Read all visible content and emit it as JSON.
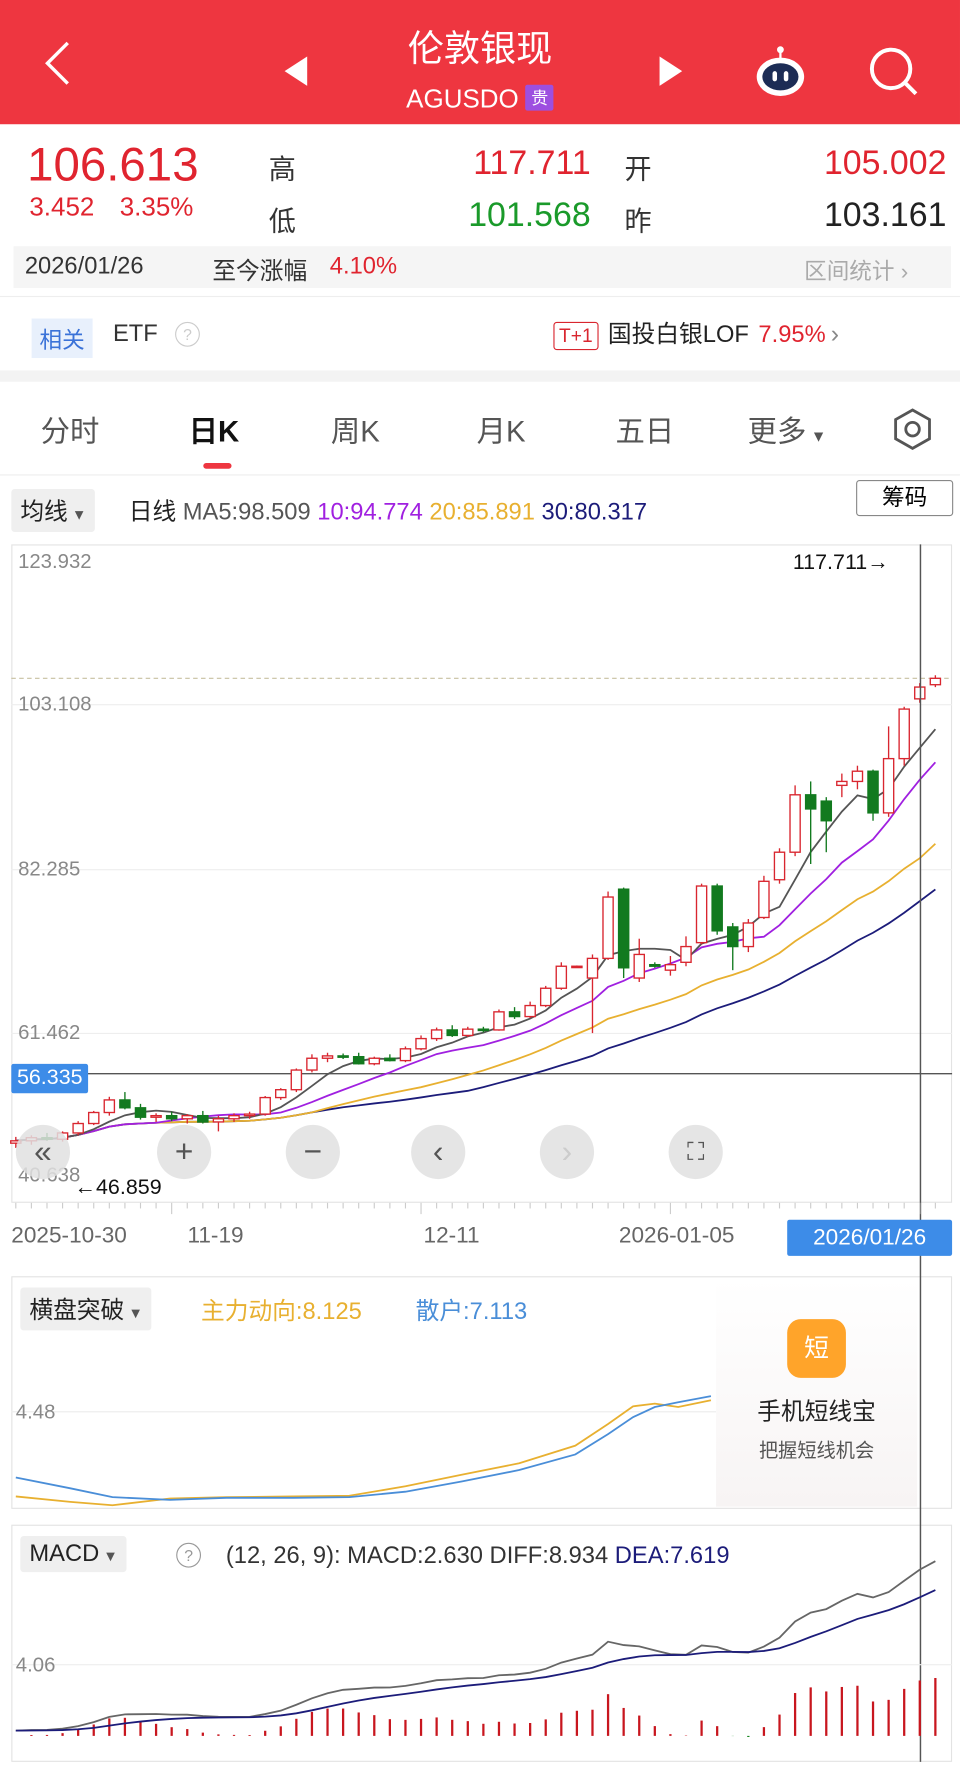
{
  "header": {
    "title": "伦敦银现",
    "code": "AGUSDO",
    "badge": "贵"
  },
  "quote": {
    "price": "106.613",
    "change": "3.452",
    "change_pct": "3.35%",
    "high_label": "高",
    "high": "117.711",
    "low_label": "低",
    "low": "101.568",
    "open_label": "开",
    "open": "105.002",
    "prev_label": "昨",
    "prev": "103.161"
  },
  "range": {
    "date": "2026/01/26",
    "label": "至今涨幅",
    "value": "4.10%",
    "stats": "区间统计"
  },
  "related": {
    "tag": "相关",
    "etf": "ETF",
    "t1": "T+1",
    "fund": "国投白银LOF",
    "pct": "7.95%"
  },
  "tabs": [
    "分时",
    "日K",
    "周K",
    "月K",
    "五日",
    "更多"
  ],
  "ma": {
    "selector": "均线",
    "period": "日线",
    "ma5": "MA5:98.509",
    "ma10": "10:94.774",
    "ma20": "20:85.891",
    "ma30": "30:80.317",
    "chips": "筹码"
  },
  "colors": {
    "up": "#d9262f",
    "down": "#127a1f",
    "ma5": "#555555",
    "ma10": "#a020e0",
    "ma20": "#e8b030",
    "ma30": "#1c1c7a"
  },
  "chart_data": [
    {
      "type": "candlestick",
      "title": "伦敦银现 日K",
      "yticks": [
        "123.932",
        "103.108",
        "82.285",
        "61.462",
        "40.638"
      ],
      "ylim": [
        40.638,
        123.932
      ],
      "current": "56.335",
      "current_value": 56.335,
      "max_label": "117.711→",
      "min_label": "←46.859",
      "xticks": [
        "2025-10-30",
        "11-19",
        "12-11",
        "2026-01-05"
      ],
      "selected_date": "2026/01/26",
      "ohlc": [
        [
          47.5,
          48.3,
          46.9,
          47.8
        ],
        [
          47.8,
          48.5,
          47.3,
          48.2
        ],
        [
          48.2,
          48.8,
          47.8,
          48.0
        ],
        [
          48.0,
          49.0,
          47.7,
          48.8
        ],
        [
          48.8,
          50.3,
          48.5,
          50.0
        ],
        [
          50.0,
          51.6,
          49.8,
          51.4
        ],
        [
          51.4,
          53.4,
          51.0,
          53.0
        ],
        [
          53.0,
          54.0,
          51.8,
          52.0
        ],
        [
          52.0,
          52.5,
          50.5,
          50.8
        ],
        [
          50.8,
          51.3,
          50.2,
          51.0
        ],
        [
          51.0,
          51.5,
          50.3,
          50.6
        ],
        [
          50.6,
          51.2,
          50.0,
          51.0
        ],
        [
          51.0,
          51.6,
          50.0,
          50.2
        ],
        [
          50.2,
          51.0,
          49.0,
          50.6
        ],
        [
          50.6,
          51.3,
          50.2,
          51.0
        ],
        [
          51.0,
          51.5,
          50.6,
          51.2
        ],
        [
          51.2,
          53.5,
          51.0,
          53.3
        ],
        [
          53.3,
          54.5,
          53.0,
          54.3
        ],
        [
          54.3,
          57.0,
          54.0,
          56.8
        ],
        [
          56.8,
          58.8,
          56.5,
          58.3
        ],
        [
          58.3,
          59.0,
          57.8,
          58.6
        ],
        [
          58.6,
          58.9,
          58.2,
          58.5
        ],
        [
          58.5,
          59.0,
          57.5,
          57.6
        ],
        [
          57.6,
          58.5,
          57.4,
          58.3
        ],
        [
          58.3,
          58.8,
          57.9,
          58.0
        ],
        [
          58.0,
          59.8,
          57.8,
          59.5
        ],
        [
          59.5,
          61.2,
          59.3,
          60.8
        ],
        [
          60.8,
          62.2,
          60.5,
          61.9
        ],
        [
          61.9,
          62.5,
          61.0,
          61.2
        ],
        [
          61.2,
          62.3,
          61.0,
          62.0
        ],
        [
          62.0,
          62.3,
          61.6,
          61.9
        ],
        [
          61.9,
          64.5,
          61.8,
          64.2
        ],
        [
          64.2,
          64.8,
          63.3,
          63.6
        ],
        [
          63.6,
          65.5,
          63.4,
          65.0
        ],
        [
          65.0,
          67.5,
          64.8,
          67.2
        ],
        [
          67.2,
          70.5,
          67.0,
          70.0
        ],
        [
          70.0,
          70.1,
          69.8,
          70.0
        ],
        [
          68.5,
          71.5,
          61.5,
          71.0
        ],
        [
          71.0,
          79.5,
          70.8,
          78.8
        ],
        [
          79.8,
          80.0,
          68.5,
          69.8
        ],
        [
          68.5,
          73.5,
          68.0,
          71.5
        ],
        [
          70.2,
          70.5,
          69.8,
          70.0
        ],
        [
          69.5,
          71.3,
          68.8,
          70.2
        ],
        [
          70.5,
          73.8,
          70.0,
          72.5
        ],
        [
          73.0,
          80.5,
          72.8,
          80.2
        ],
        [
          80.2,
          80.5,
          74.0,
          74.5
        ],
        [
          75.0,
          75.5,
          69.5,
          72.5
        ],
        [
          72.5,
          76.0,
          71.8,
          75.5
        ],
        [
          76.2,
          81.5,
          76.0,
          80.8
        ],
        [
          81.0,
          85.0,
          80.5,
          84.5
        ],
        [
          84.5,
          93.0,
          84.0,
          91.8
        ],
        [
          91.8,
          93.5,
          83.0,
          90.0
        ],
        [
          91.0,
          91.5,
          84.5,
          88.5
        ],
        [
          93.0,
          94.5,
          91.5,
          93.5
        ],
        [
          93.5,
          95.5,
          92.5,
          94.8
        ],
        [
          94.8,
          95.0,
          88.5,
          89.5
        ],
        [
          89.5,
          100.5,
          89.0,
          96.4
        ],
        [
          96.4,
          103.0,
          95.5,
          102.7
        ],
        [
          104.0,
          106.0,
          103.5,
          105.5
        ],
        [
          105.8,
          107.0,
          105.5,
          106.613
        ]
      ]
    },
    {
      "type": "line",
      "title": "横盘突破",
      "legend": [
        "主力动向:8.125",
        "散户:7.113"
      ],
      "ytick": "4.48",
      "x": [
        0,
        3.5,
        6.2,
        9.9,
        13.5,
        17.8,
        21.4,
        25,
        28.6,
        32.3,
        35.9,
        38,
        39.6,
        41,
        42.5,
        44.6
      ],
      "series": [
        {
          "name": "主力动向",
          "values": [
            3.23,
            3.15,
            3.1,
            3.2,
            3.22,
            3.23,
            3.24,
            3.38,
            3.55,
            3.72,
            3.98,
            4.3,
            4.56,
            4.6,
            4.55,
            4.65
          ]
        },
        {
          "name": "散户",
          "values": [
            3.51,
            3.35,
            3.22,
            3.18,
            3.21,
            3.21,
            3.22,
            3.3,
            3.45,
            3.62,
            3.85,
            4.15,
            4.4,
            4.55,
            4.62,
            4.71
          ]
        }
      ]
    },
    {
      "type": "macd",
      "title": "MACD",
      "params": "(12, 26, 9):",
      "macd": "MACD:2.630",
      "diff": "DIFF:8.934",
      "dea": "DEA:7.619",
      "ytick": "4.06"
    }
  ],
  "zoom_controls": [
    "«",
    "+",
    "−",
    "‹",
    "›",
    "⛶"
  ],
  "ad": {
    "icon": "短",
    "title": "手机短线宝",
    "subtitle": "把握短线机会"
  }
}
